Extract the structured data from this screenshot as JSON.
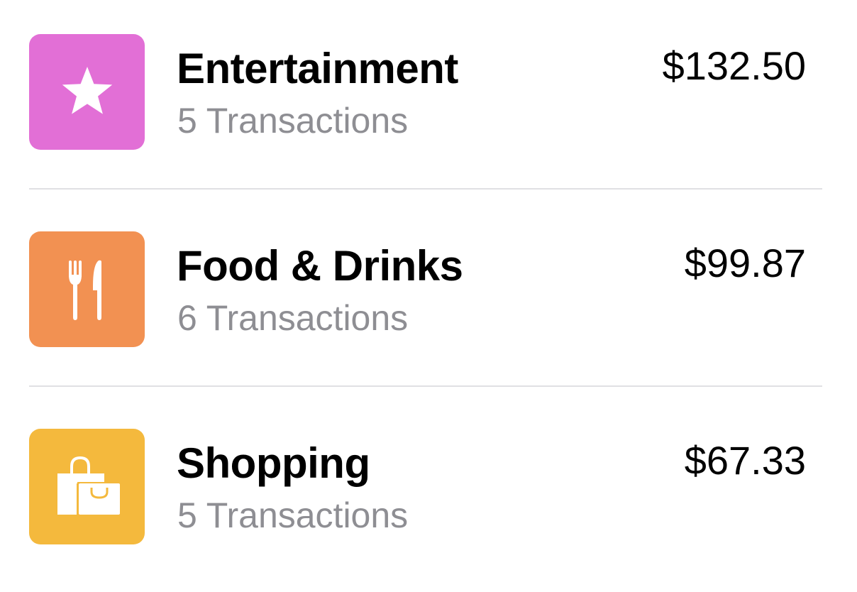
{
  "categories": [
    {
      "name": "Entertainment",
      "transactions": "5 Transactions",
      "amount": "$132.50",
      "icon": "star-icon",
      "color": "#e26fd6"
    },
    {
      "name": "Food & Drinks",
      "transactions": "6 Transactions",
      "amount": "$99.87",
      "icon": "fork-knife-icon",
      "color": "#f29152"
    },
    {
      "name": "Shopping",
      "transactions": "5 Transactions",
      "amount": "$67.33",
      "icon": "shopping-bags-icon",
      "color": "#f4b93d"
    }
  ],
  "colors": {
    "title": "#000000",
    "subtitle": "#8e8e93",
    "divider": "#e0e0e3",
    "background": "#ffffff"
  }
}
